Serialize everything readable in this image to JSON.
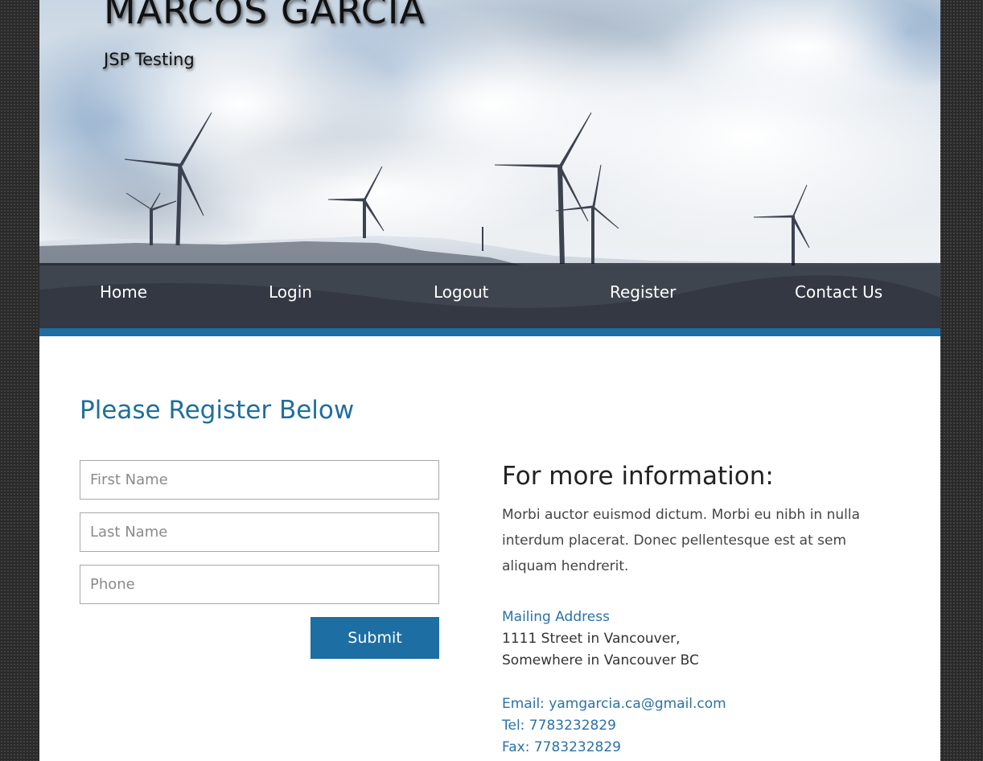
{
  "header": {
    "title": "MARCOS GARCIA",
    "subtitle": "JSP Testing"
  },
  "nav": {
    "items": [
      {
        "label": "Home"
      },
      {
        "label": "Login"
      },
      {
        "label": "Logout"
      },
      {
        "label": "Register"
      },
      {
        "label": "Contact Us"
      }
    ]
  },
  "colors": {
    "accent": "#1d6fa3",
    "link": "#2b72a6",
    "nav_overlay": "#0c101a"
  },
  "register": {
    "heading": "Please Register Below",
    "fields": [
      {
        "placeholder": "First Name",
        "value": ""
      },
      {
        "placeholder": "Last Name",
        "value": ""
      },
      {
        "placeholder": "Phone",
        "value": ""
      }
    ],
    "submit_label": "Submit"
  },
  "info": {
    "heading": "For more information:",
    "body": "Morbi auctor euismod dictum. Morbi eu nibh in nulla interdum placerat. Donec pellentesque est at sem aliquam hendrerit.",
    "mailing_label": "Mailing Address",
    "address_lines": [
      "1111 Street in Vancouver,",
      "Somewhere in Vancouver BC"
    ],
    "email": "Email: yamgarcia.ca@gmail.com",
    "tel": "Tel: 7783232829",
    "fax": "Fax: 7783232829"
  },
  "hero": {
    "image_icon": "wind-turbines-landscape"
  }
}
